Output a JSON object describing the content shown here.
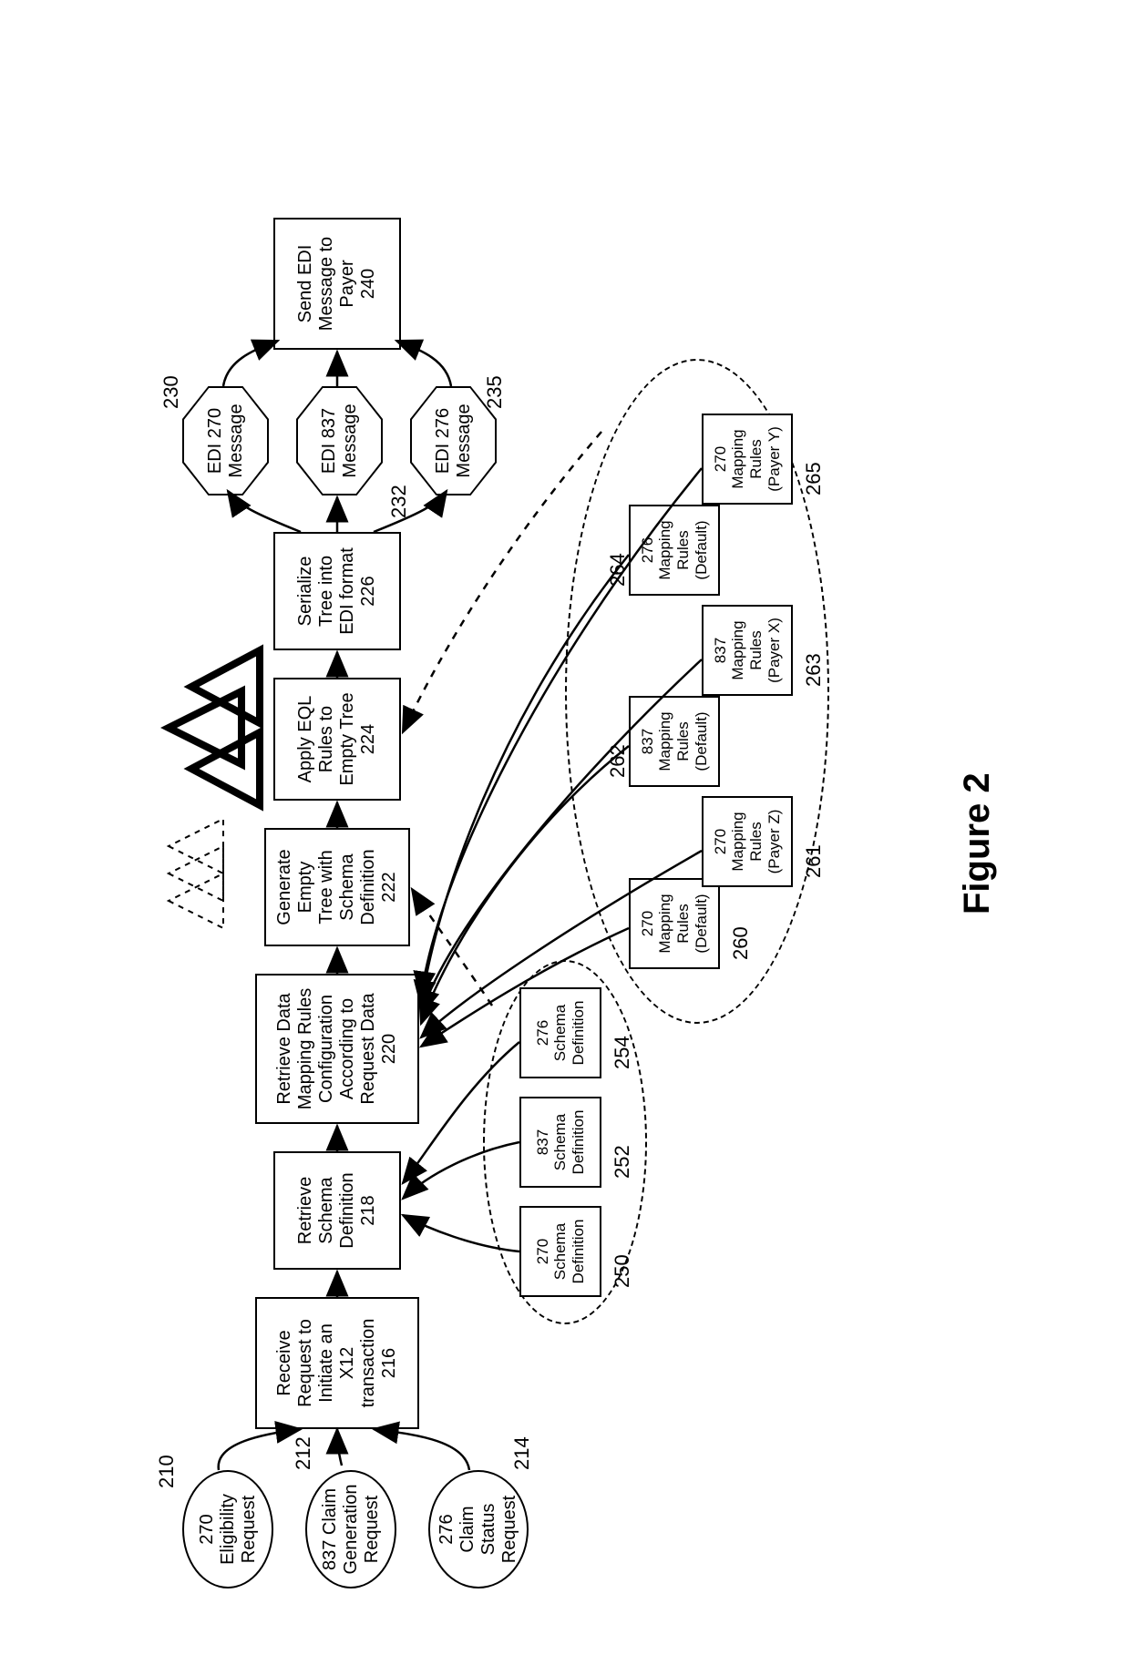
{
  "figure_label": "Figure 2",
  "inputs": {
    "eligibility": {
      "text": "270\nEligibility\nRequest",
      "ref": "210"
    },
    "claim_gen": {
      "text": "837 Claim\nGeneration\nRequest",
      "ref": "212"
    },
    "claim_status": {
      "text": "276\nClaim\nStatus\nRequest",
      "ref": "214"
    }
  },
  "steps": {
    "receive": {
      "text": "Receive\nRequest to\nInitiate an\nX12\ntransaction\n216"
    },
    "schema": {
      "text": "Retrieve\nSchema\nDefinition\n218"
    },
    "mapping": {
      "text": "Retrieve Data\nMapping Rules\nConfiguration\nAccording to\nRequest Data\n220"
    },
    "tree": {
      "text": "Generate\nEmpty\nTree with\nSchema\nDefinition\n222"
    },
    "apply": {
      "text": "Apply EQL\nRules to\nEmpty Tree\n224"
    },
    "serialize": {
      "text": "Serialize\nTree into\nEDI format\n226"
    },
    "send": {
      "text": "Send EDI\nMessage to\nPayer\n240"
    }
  },
  "schemas": {
    "s270": {
      "text": "270\nSchema\nDefinition",
      "ref": "250"
    },
    "s837": {
      "text": "837\nSchema\nDefinition",
      "ref": "252"
    },
    "s276": {
      "text": "276\nSchema\nDefinition",
      "ref": "254"
    }
  },
  "rules": {
    "r270d": {
      "text": "270\nMapping\nRules\n(Default)",
      "ref": "260"
    },
    "r270z": {
      "text": "270\nMapping\nRules\n(Payer Z)",
      "ref": "261"
    },
    "r837d": {
      "text": "837\nMapping\nRules\n(Default)",
      "ref": "262"
    },
    "r837x": {
      "text": "837\nMapping\nRules\n(Payer X)",
      "ref": "263"
    },
    "r276d": {
      "text": "276\nMapping\nRules\n(Default)",
      "ref": "264"
    },
    "r270y": {
      "text": "270\nMapping\nRules\n(Payer Y)",
      "ref": "265"
    }
  },
  "edi": {
    "e270": {
      "text": "EDI 270\nMessage",
      "ref": "230"
    },
    "e837": {
      "text": "EDI 837\nMessage",
      "ref": "232"
    },
    "e276": {
      "text": "EDI 276\nMessage",
      "ref": "235"
    }
  }
}
